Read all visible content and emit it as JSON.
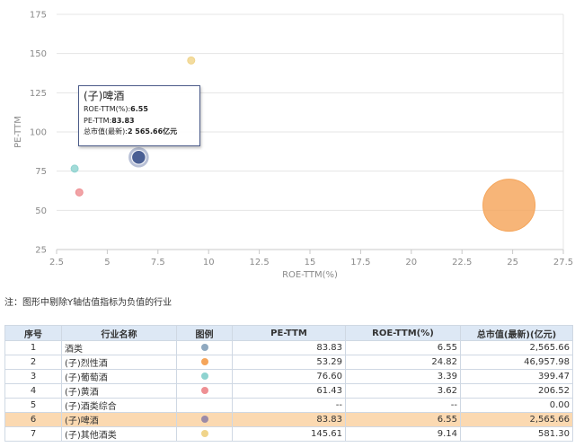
{
  "chart_data": {
    "type": "scatter",
    "xlabel": "ROE-TTM(%)",
    "ylabel": "PE-TTM",
    "xlim": [
      2.5,
      27.5
    ],
    "ylim": [
      25,
      175
    ],
    "xticks": [
      "2.5",
      "5",
      "7.5",
      "10",
      "12.5",
      "15",
      "17.5",
      "20",
      "22.5",
      "25",
      "27.5"
    ],
    "yticks": [
      "25",
      "50",
      "75",
      "100",
      "125",
      "150",
      "175"
    ],
    "grid": "horizontal",
    "points": [
      {
        "name": "(子)烈性酒",
        "x": 24.82,
        "y": 53.29,
        "size": 46957.98,
        "color": "#f5a55a"
      },
      {
        "name": "(子)葡萄酒",
        "x": 3.39,
        "y": 76.6,
        "size": 399.47,
        "color": "#8ed3d0"
      },
      {
        "name": "(子)黄酒",
        "x": 3.62,
        "y": 61.43,
        "size": 206.52,
        "color": "#ee8f93"
      },
      {
        "name": "(子)啤酒",
        "x": 6.55,
        "y": 83.83,
        "size": 2565.66,
        "color": "#4a5f94"
      },
      {
        "name": "(子)其他酒类",
        "x": 9.14,
        "y": 145.61,
        "size": 581.3,
        "color": "#f0d48a"
      }
    ]
  },
  "tooltip": {
    "title": "(子)啤酒",
    "roe_label": "ROE-TTM(%):",
    "roe_value": "6.55",
    "pe_label": "PE-TTM:",
    "pe_value": "83.83",
    "cap_label": "总市值(最新):",
    "cap_value": "2 565.66亿元"
  },
  "note": "注：图形中剔除Y轴估值指标为负值的行业",
  "table": {
    "headers": [
      "序号",
      "行业名称",
      "图例",
      "PE-TTM",
      "ROE-TTM(%)",
      "总市值(最新)(亿元)"
    ],
    "rows": [
      {
        "idx": "1",
        "name": "酒类",
        "legend": "#8fa9c0",
        "pe": "83.83",
        "roe": "6.55",
        "cap": "2,565.66",
        "highlight": false
      },
      {
        "idx": "2",
        "name": "(子)烈性酒",
        "legend": "#f5a55a",
        "pe": "53.29",
        "roe": "24.82",
        "cap": "46,957.98",
        "highlight": false
      },
      {
        "idx": "3",
        "name": "(子)葡萄酒",
        "legend": "#8ed3d0",
        "pe": "76.60",
        "roe": "3.39",
        "cap": "399.47",
        "highlight": false
      },
      {
        "idx": "4",
        "name": "(子)黄酒",
        "legend": "#ee8f93",
        "pe": "61.43",
        "roe": "3.62",
        "cap": "206.52",
        "highlight": false
      },
      {
        "idx": "5",
        "name": "(子)酒类综合",
        "legend": "",
        "pe": "--",
        "roe": "--",
        "cap": "0.00",
        "highlight": false
      },
      {
        "idx": "6",
        "name": "(子)啤酒",
        "legend": "#9b8aa8",
        "pe": "83.83",
        "roe": "6.55",
        "cap": "2,565.66",
        "highlight": true
      },
      {
        "idx": "7",
        "name": "(子)其他酒类",
        "legend": "#f0d48a",
        "pe": "145.61",
        "roe": "9.14",
        "cap": "581.30",
        "highlight": false
      }
    ]
  }
}
